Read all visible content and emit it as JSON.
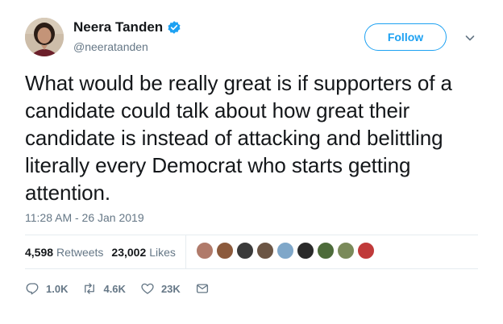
{
  "author": {
    "name": "Neera Tanden",
    "handle": "@neeratanden",
    "verified": true
  },
  "follow_label": "Follow",
  "tweet": {
    "text": "What would be really great is if supporters of a candidate could talk about how great their candidate is instead of attacking and belittling literally every Democrat who starts getting attention.",
    "timestamp": "11:28 AM - 26 Jan 2019"
  },
  "stats": {
    "retweets_count": "4,598",
    "retweets_label": "Retweets",
    "likes_count": "23,002",
    "likes_label": "Likes"
  },
  "likers": {
    "count": 9,
    "colors": [
      "#b07a6a",
      "#8c5a3c",
      "#3a3a3a",
      "#6b5544",
      "#7fa7c9",
      "#2a2a2a",
      "#4d6b3a",
      "#7a8a5a",
      "#c03a3a"
    ]
  },
  "actions": {
    "reply_count": "1.0K",
    "retweet_count": "4.6K",
    "like_count": "23K"
  },
  "colors": {
    "accent": "#1da1f2",
    "secondary_text": "#657786",
    "divider": "#e6ecf0"
  },
  "icons": {
    "verified": "verified-badge-icon",
    "caret": "chevron-down-icon",
    "reply": "reply-icon",
    "retweet": "retweet-icon",
    "like": "heart-icon",
    "dm": "envelope-icon"
  }
}
